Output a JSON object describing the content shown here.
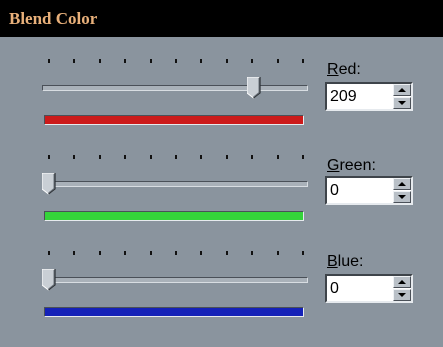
{
  "window": {
    "title": "Blend Color"
  },
  "channels": [
    {
      "name": "red",
      "label_accel": "R",
      "label_rest": "ed:",
      "value": "209",
      "slider_fraction": 0.8196,
      "swatch_color": "#cc1a1a"
    },
    {
      "name": "green",
      "label_accel": "G",
      "label_rest": "reen:",
      "value": "0",
      "slider_fraction": 0,
      "swatch_color": "#35d43a"
    },
    {
      "name": "blue",
      "label_accel": "B",
      "label_rest": "lue:",
      "value": "0",
      "slider_fraction": 0,
      "swatch_color": "#1421b8"
    }
  ],
  "icons": {
    "spin_up": "arrow-up-icon",
    "spin_down": "arrow-down-icon",
    "slider_thumb": "slider-thumb"
  },
  "colors": {
    "titlebar": "#000000",
    "title_text": "#e8b07a",
    "panel": "#8a949e"
  }
}
